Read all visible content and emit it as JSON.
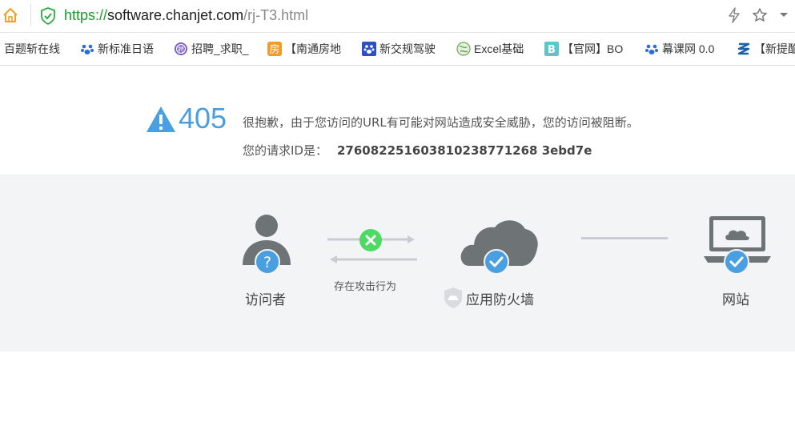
{
  "browser": {
    "url_scheme": "https://",
    "url_host": "software.chanjet.com",
    "url_path": "/rj-T3.html"
  },
  "bookmarks": [
    {
      "label": "百题斩在线",
      "icon": "none"
    },
    {
      "label": "新标准日语",
      "icon": "baidu-paw-icon"
    },
    {
      "label": "招聘_求职_",
      "icon": "recruit-icon"
    },
    {
      "label": "【南通房地",
      "icon": "house-icon"
    },
    {
      "label": "新交规驾驶",
      "icon": "paw-icon"
    },
    {
      "label": "Excel基础",
      "icon": "globe-icon"
    },
    {
      "label": "【官网】BO",
      "icon": "b-letter-icon"
    },
    {
      "label": "幕课网 0.0",
      "icon": "baidu-paw-icon"
    },
    {
      "label": "【新提酷",
      "icon": "s-logo-icon"
    }
  ],
  "error": {
    "code": "405",
    "message": "很抱歉，由于您访问的URL有可能对网站造成安全威胁，您的访问被阻断。",
    "request_label": "您的请求ID是：",
    "request_id": "276082251603810238771268 3ebd7e"
  },
  "diagram": {
    "visitor_label": "访问者",
    "attack_label": "存在攻击行为",
    "firewall_label": "应用防火墙",
    "website_label": "网站"
  },
  "colors": {
    "accent_blue": "#4a9fe0",
    "danger_green": "#4cd964",
    "icon_gray": "#6e7375",
    "diagram_bg": "#f3f4f6"
  }
}
